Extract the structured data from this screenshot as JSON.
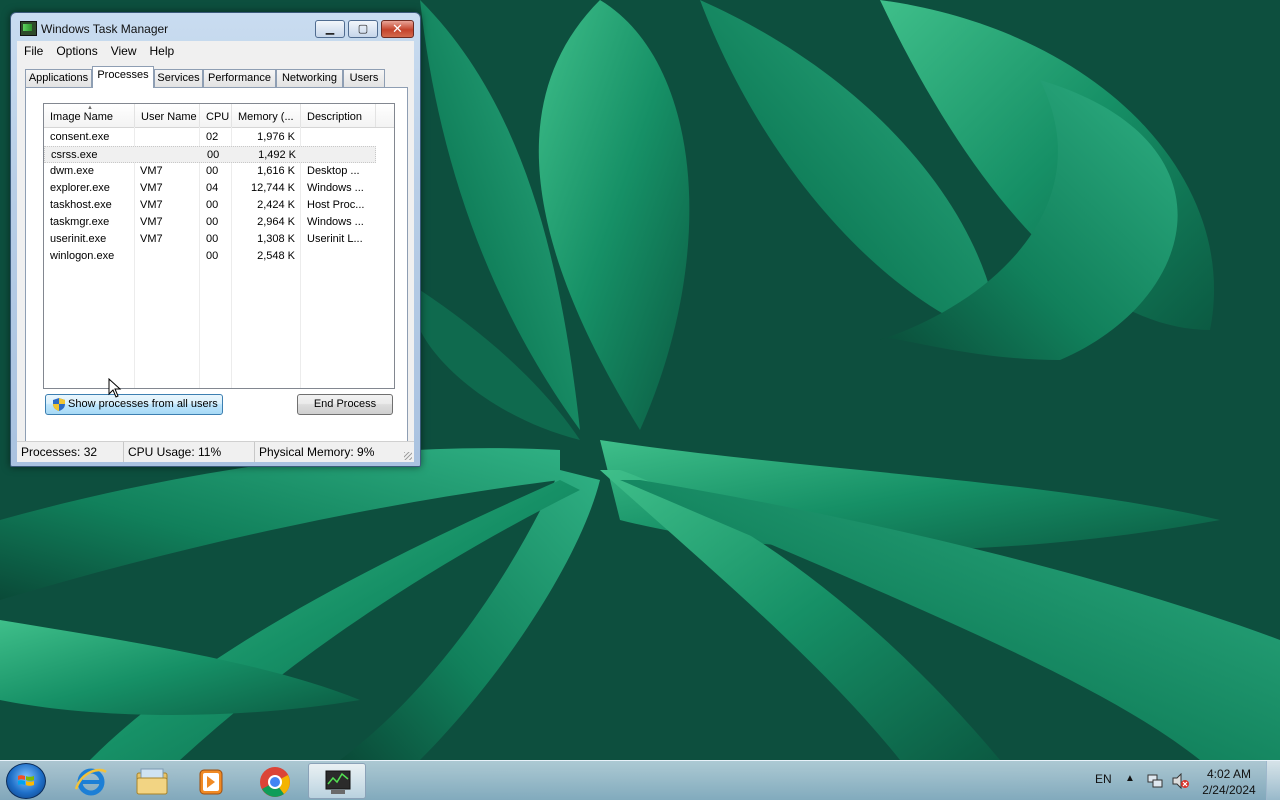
{
  "window": {
    "title": "Windows Task Manager",
    "min_label": "▁",
    "max_label": "▢",
    "close_label": "✕"
  },
  "menu": [
    "File",
    "Options",
    "View",
    "Help"
  ],
  "tabs": [
    "Applications",
    "Processes",
    "Services",
    "Performance",
    "Networking",
    "Users"
  ],
  "active_tab": "Processes",
  "columns": [
    "Image Name",
    "User Name",
    "CPU",
    "Memory (...",
    "Description"
  ],
  "processes": [
    {
      "image": "consent.exe",
      "user": "",
      "cpu": "02",
      "memory": "1,976 K",
      "description": ""
    },
    {
      "image": "csrss.exe",
      "user": "",
      "cpu": "00",
      "memory": "1,492 K",
      "description": ""
    },
    {
      "image": "dwm.exe",
      "user": "VM7",
      "cpu": "00",
      "memory": "1,616 K",
      "description": "Desktop ..."
    },
    {
      "image": "explorer.exe",
      "user": "VM7",
      "cpu": "04",
      "memory": "12,744 K",
      "description": "Windows ..."
    },
    {
      "image": "taskhost.exe",
      "user": "VM7",
      "cpu": "00",
      "memory": "2,424 K",
      "description": "Host Proc..."
    },
    {
      "image": "taskmgr.exe",
      "user": "VM7",
      "cpu": "00",
      "memory": "2,964 K",
      "description": "Windows ..."
    },
    {
      "image": "userinit.exe",
      "user": "VM7",
      "cpu": "00",
      "memory": "1,308 K",
      "description": "Userinit L..."
    },
    {
      "image": "winlogon.exe",
      "user": "",
      "cpu": "00",
      "memory": "2,548 K",
      "description": ""
    }
  ],
  "selected_row": "csrss.exe",
  "buttons": {
    "show_all": "Show processes from all users",
    "end_process": "End Process"
  },
  "status": {
    "processes": "Processes: 32",
    "cpu": "CPU Usage: 11%",
    "memory": "Physical Memory: 9%"
  },
  "taskbar": {
    "apps": [
      "start-orb",
      "internet-explorer-icon",
      "file-explorer-icon",
      "media-player-icon",
      "chrome-icon",
      "task-manager-icon"
    ],
    "language": "EN",
    "time": "4:02 AM",
    "date": "2/24/2024"
  },
  "colors": {
    "selection_accent": "#3c7fb1",
    "close_red": "#c4432b",
    "wallpaper_green": "#17805f"
  }
}
